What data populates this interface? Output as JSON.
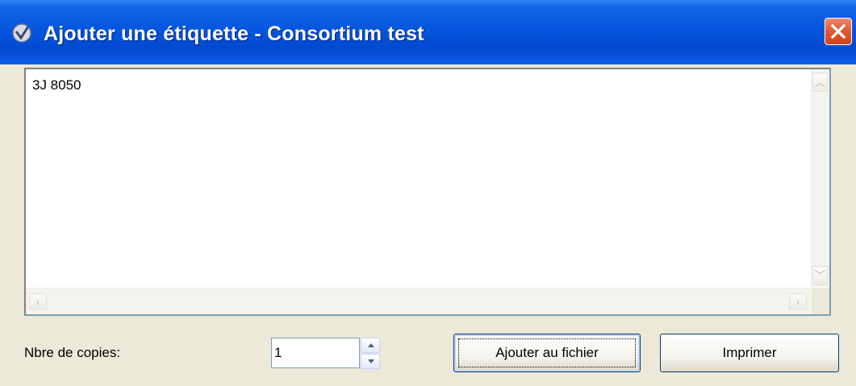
{
  "window": {
    "title": "Ajouter une étiquette - Consortium test",
    "icon": "app-check-icon",
    "close": "close-icon"
  },
  "label_text": "3J 8050",
  "copies": {
    "label": "Nbre de copies:",
    "value": "1"
  },
  "buttons": {
    "add_to_file": "Ajouter au fichier",
    "print": "Imprimer"
  },
  "colors": {
    "titlebar": "#0655DE",
    "close": "#E05B35",
    "face": "#ECE9D8"
  }
}
